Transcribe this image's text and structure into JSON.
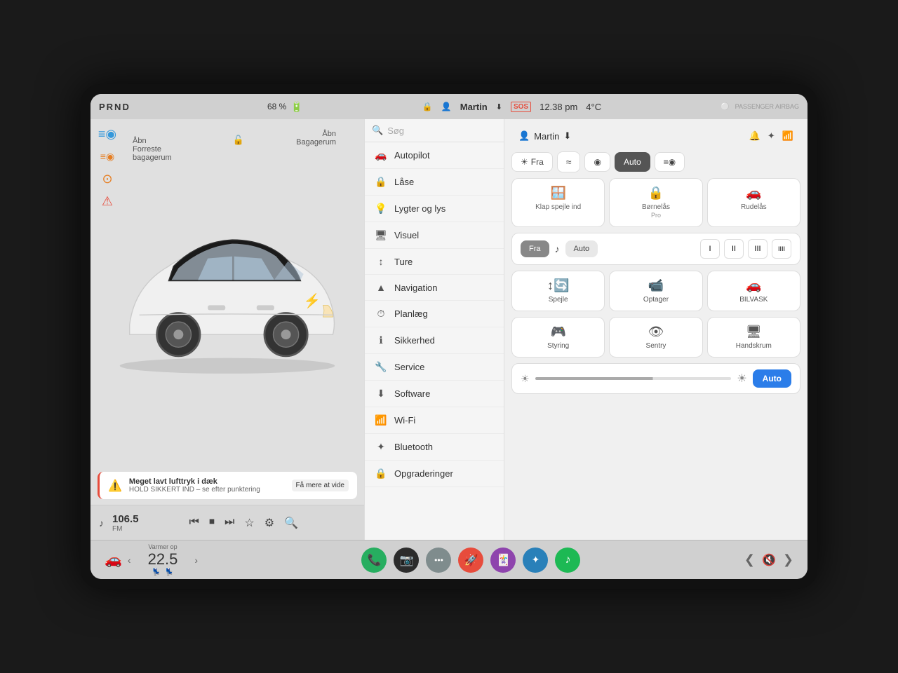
{
  "statusBar": {
    "prnd": "PRND",
    "battery": "68 %",
    "batteryIcon": "🔋",
    "user": "Martin",
    "time": "12.38 pm",
    "temp": "4°C",
    "sos": "SOS",
    "passengerAirbag": "PASSENGER AIRBAG"
  },
  "leftPanel": {
    "labelTopLeft1": "Åbn",
    "labelTopLeft2": "Forreste",
    "labelTopLeft3": "bagagerum",
    "labelTopRight1": "Åbn",
    "labelTopRight2": "Bagagerum"
  },
  "alert": {
    "title": "Meget lavt lufttryk i dæk",
    "subtitle": "HOLD SIKKERT IND – se efter punktering",
    "link": "Få mere at vide"
  },
  "radio": {
    "freq": "106.5",
    "band": "FM"
  },
  "search": {
    "placeholder": "Søg"
  },
  "menu": {
    "items": [
      {
        "icon": "🚗",
        "label": "Autopilot"
      },
      {
        "icon": "🔒",
        "label": "Låse"
      },
      {
        "icon": "💡",
        "label": "Lygter og lys"
      },
      {
        "icon": "🖥",
        "label": "Visuel"
      },
      {
        "icon": "↕",
        "label": "Ture"
      },
      {
        "icon": "▲",
        "label": "Navigation"
      },
      {
        "icon": "⏱",
        "label": "Planlæg"
      },
      {
        "icon": "ℹ",
        "label": "Sikkerhed"
      },
      {
        "icon": "🔧",
        "label": "Service"
      },
      {
        "icon": "⬇",
        "label": "Software"
      },
      {
        "icon": "📶",
        "label": "Wi-Fi"
      },
      {
        "icon": "✦",
        "label": "Bluetooth"
      },
      {
        "icon": "🔒",
        "label": "Opgraderinger"
      }
    ]
  },
  "rightPanel": {
    "user": "Martin",
    "lightButtons": [
      {
        "label": "Fra",
        "icon": "☀",
        "active": false
      },
      {
        "label": "≈",
        "active": false
      },
      {
        "label": "◉",
        "active": false
      },
      {
        "label": "Auto",
        "active": true
      },
      {
        "label": "≡◉",
        "active": false
      }
    ],
    "controlButtons": [
      {
        "icon": "🪟",
        "label": "Klap spejle ind",
        "sublabel": ""
      },
      {
        "icon": "🔒",
        "label": "Børnelås",
        "sublabel": "Pro"
      },
      {
        "icon": "🚗",
        "label": "Rudelås",
        "sublabel": ""
      }
    ],
    "wiperButtons": [
      {
        "label": "Fra",
        "active": true
      },
      {
        "label": "Auto",
        "active": false
      }
    ],
    "wiperSpeeds": [
      "I",
      "II",
      "III",
      "IIII"
    ],
    "featureButtons": [
      {
        "icon": "🔄",
        "label": "Spejle",
        "sublabel": ""
      },
      {
        "icon": "📹",
        "label": "Optager",
        "sublabel": ""
      },
      {
        "icon": "🚗",
        "label": "BILVASK",
        "sublabel": ""
      }
    ],
    "featureButtons2": [
      {
        "icon": "🎮",
        "label": "Styring",
        "sublabel": ""
      },
      {
        "icon": "👁",
        "label": "Sentry",
        "sublabel": ""
      },
      {
        "icon": "🧤",
        "label": "Handskrum",
        "sublabel": ""
      }
    ],
    "autoBtn": "Auto",
    "brightnessIcon": "☀"
  },
  "taskbar": {
    "tempLabel": "Varmer op",
    "tempValue": "22.5",
    "chevronLeft": "‹",
    "chevronRight": "›",
    "apps": [
      {
        "icon": "📞",
        "type": "phone",
        "label": "Phone"
      },
      {
        "icon": "📷",
        "type": "camera",
        "label": "Camera"
      },
      {
        "icon": "•••",
        "type": "dots",
        "label": "More"
      },
      {
        "icon": "🚀",
        "type": "rocket",
        "label": "Rocket"
      },
      {
        "icon": "🃏",
        "type": "cards",
        "label": "Cards"
      },
      {
        "icon": "✦",
        "type": "bt",
        "label": "Bluetooth"
      },
      {
        "icon": "♪",
        "type": "spotify",
        "label": "Spotify"
      }
    ],
    "volumeIcon": "🔇",
    "chevrons": "❮  ❯"
  }
}
